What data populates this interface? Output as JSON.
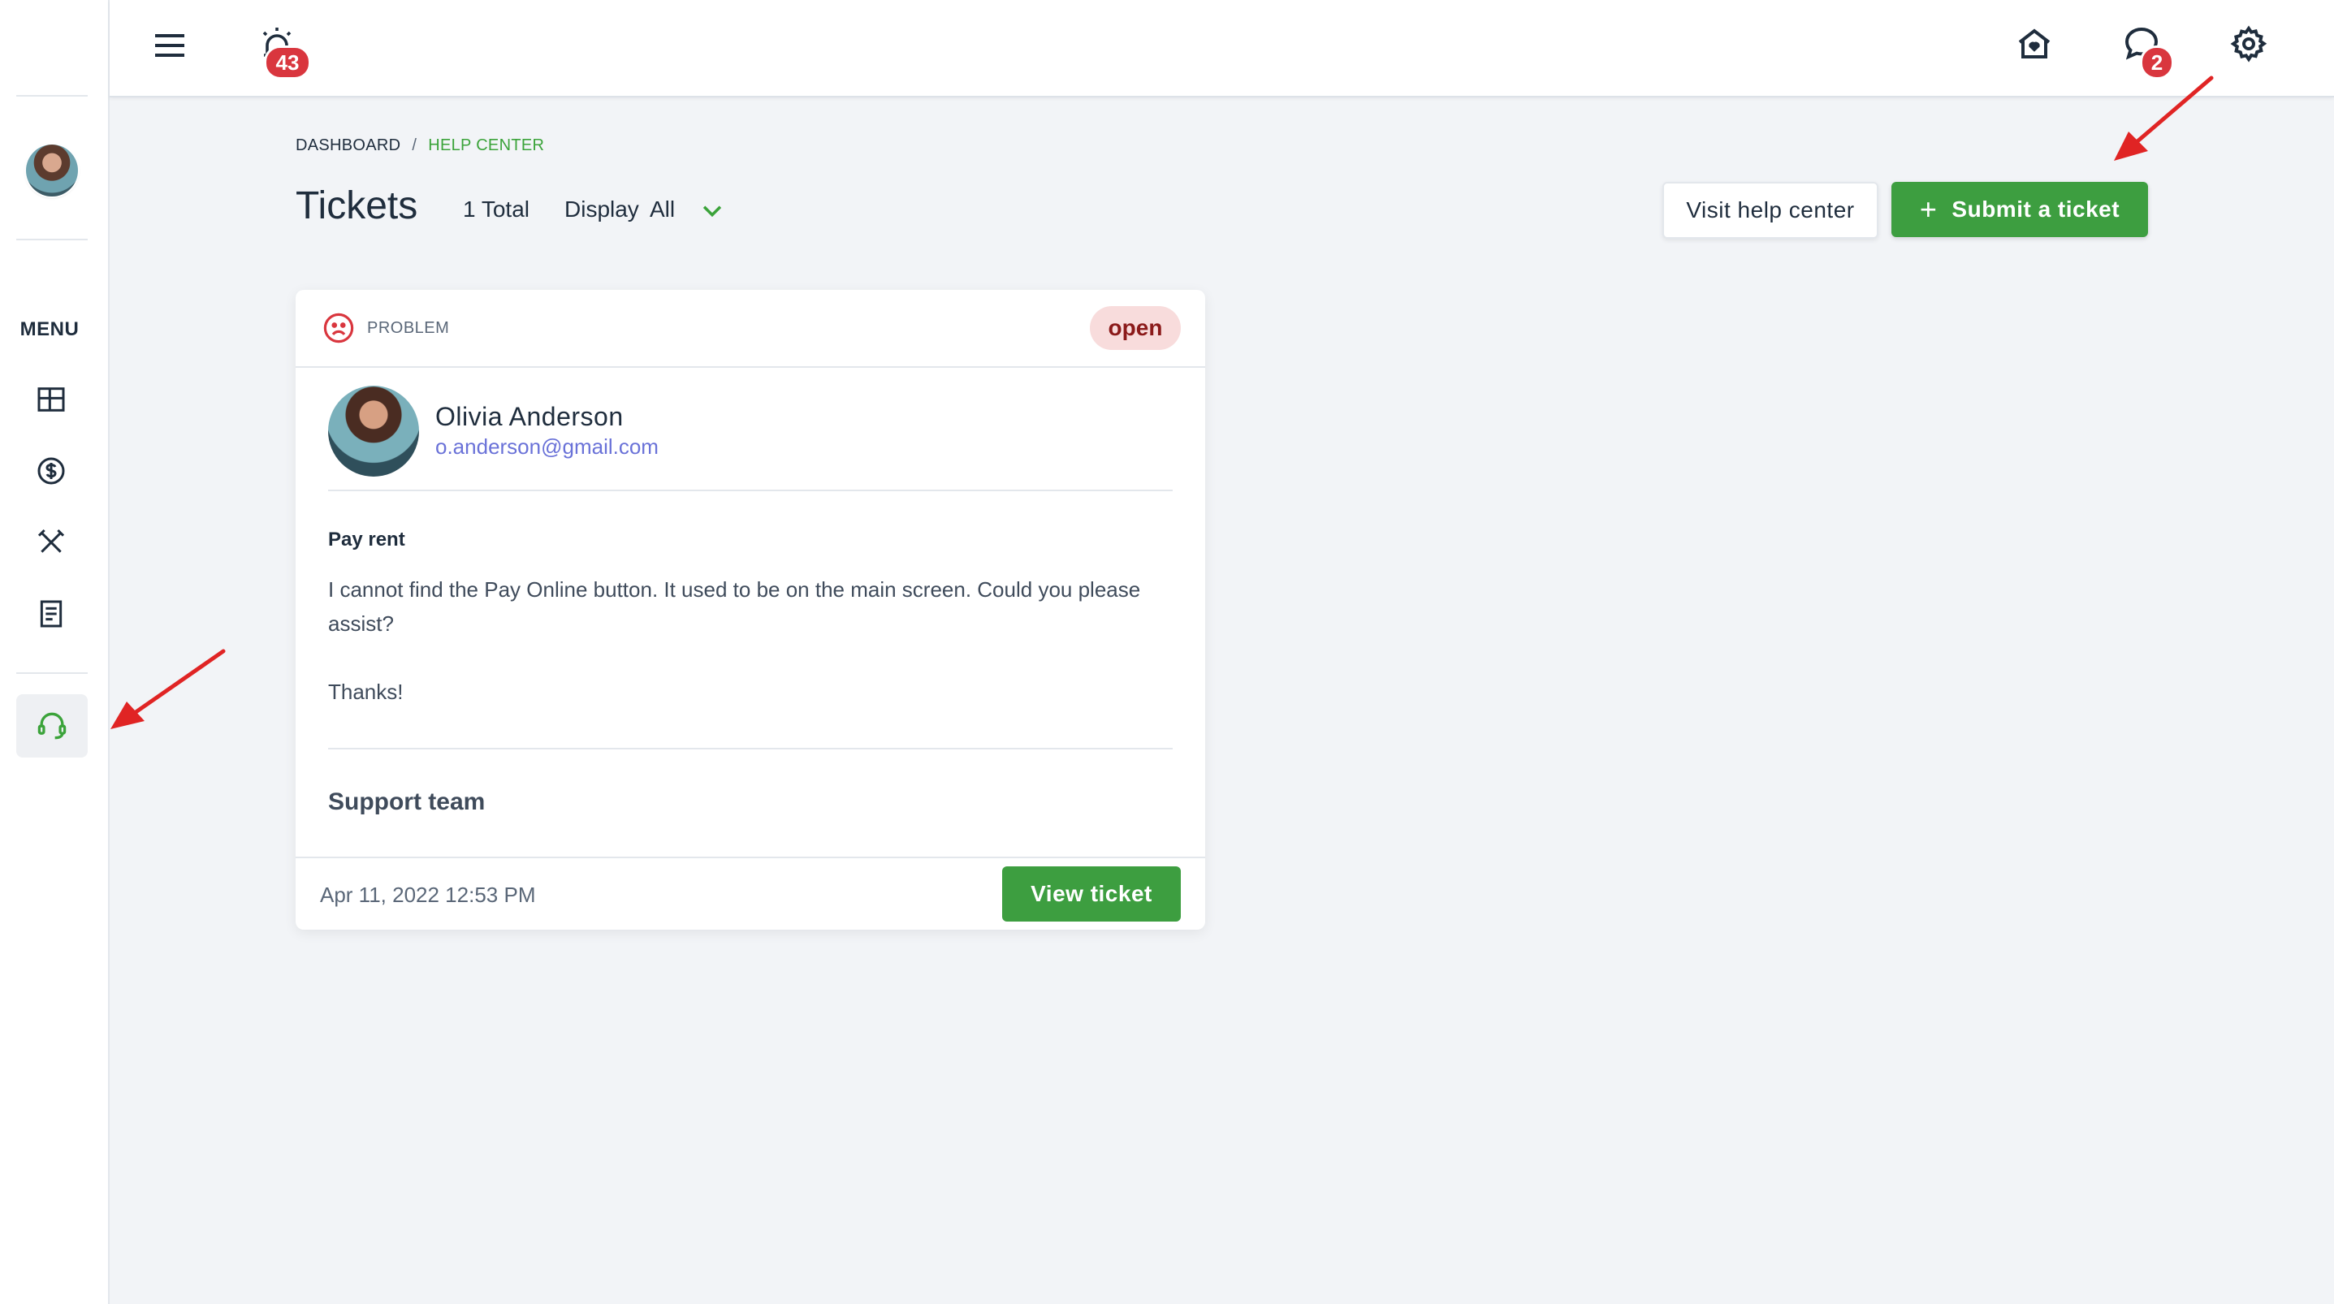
{
  "sidebar": {
    "menu_label": "MENU",
    "items": [
      {
        "icon": "dashboard-icon"
      },
      {
        "icon": "dollar-icon"
      },
      {
        "icon": "tools-icon"
      },
      {
        "icon": "document-icon"
      },
      {
        "icon": "headset-icon",
        "active": true
      }
    ]
  },
  "topbar": {
    "alarm_count": "43",
    "messages_count": "2"
  },
  "breadcrumb": {
    "items": [
      "DASHBOARD",
      "HELP CENTER"
    ],
    "separator": "/"
  },
  "header": {
    "title": "Tickets",
    "total": "1 Total",
    "display_label": "Display",
    "display_value": "All",
    "visit_label": "Visit help center",
    "submit_label": "Submit a ticket"
  },
  "ticket": {
    "type": "PROBLEM",
    "status": "open",
    "user_name": "Olivia Anderson",
    "user_email": "o.anderson@gmail.com",
    "subject": "Pay rent",
    "body": "I cannot find the Pay Online button. It used to be on the main screen. Could you please assist?\n\nThanks!",
    "team": "Support team",
    "date": "Apr 11, 2022 12:53 PM",
    "view_label": "View ticket"
  },
  "colors": {
    "accent_green": "#3d9e40",
    "badge_red": "#d9363e",
    "status_bg": "#f8dcdc",
    "email_link": "#6a72d8"
  }
}
